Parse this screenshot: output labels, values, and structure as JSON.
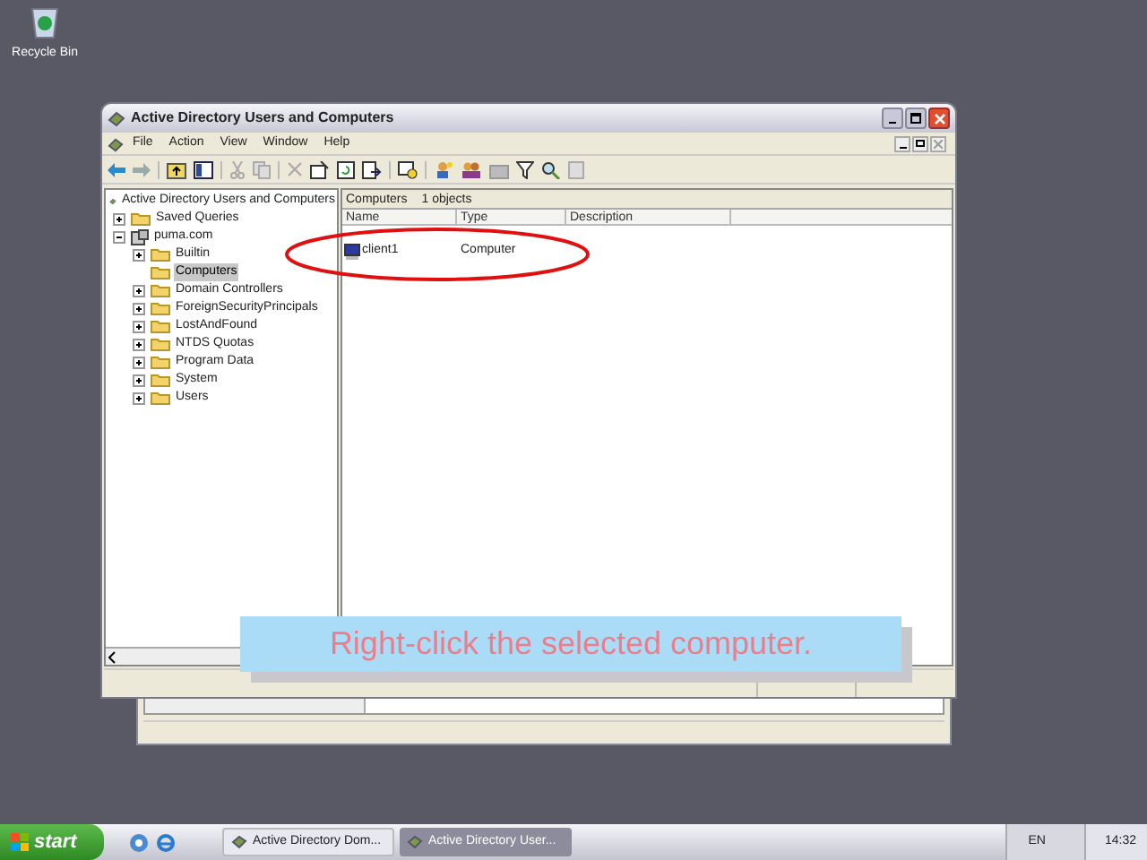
{
  "desktop": {
    "icons": [
      {
        "label": "Recycle Bin"
      }
    ]
  },
  "window": {
    "title": "Active Directory Users and Computers",
    "menu": [
      "File",
      "Action",
      "View",
      "Window",
      "Help"
    ],
    "tree": [
      {
        "label": "Active Directory Users and Computers",
        "selected": false,
        "children": [
          {
            "label": "Saved Queries",
            "selected": false,
            "expanded": false
          },
          {
            "label": "puma.com",
            "selected": false,
            "expanded": true,
            "children": [
              {
                "label": "Builtin",
                "selected": false,
                "expanded": false
              },
              {
                "label": "Computers",
                "selected": true
              },
              {
                "label": "Domain Controllers",
                "selected": false,
                "expanded": false
              },
              {
                "label": "ForeignSecurityPrincipals",
                "selected": false,
                "expanded": false
              },
              {
                "label": "LostAndFound",
                "selected": false,
                "expanded": false
              },
              {
                "label": "NTDS Quotas",
                "selected": false,
                "expanded": false
              },
              {
                "label": "Program Data",
                "selected": false,
                "expanded": false
              },
              {
                "label": "System",
                "selected": false,
                "expanded": false
              },
              {
                "label": "Users",
                "selected": false,
                "expanded": false
              }
            ]
          }
        ]
      }
    ],
    "list": {
      "title": "Computers",
      "count": "1 objects",
      "columns": [
        "Name",
        "Type",
        "Description"
      ],
      "rows": [
        {
          "cells": [
            "client1",
            "Computer",
            ""
          ]
        }
      ]
    }
  },
  "callout": {
    "text": "Right-click the selected computer."
  },
  "taskbar": {
    "start": "start",
    "tasks": [
      {
        "label": "Active Directory Dom...",
        "selected": false
      },
      {
        "label": "Active Directory User...",
        "selected": true
      }
    ],
    "language": "EN",
    "clock": "14:32"
  }
}
